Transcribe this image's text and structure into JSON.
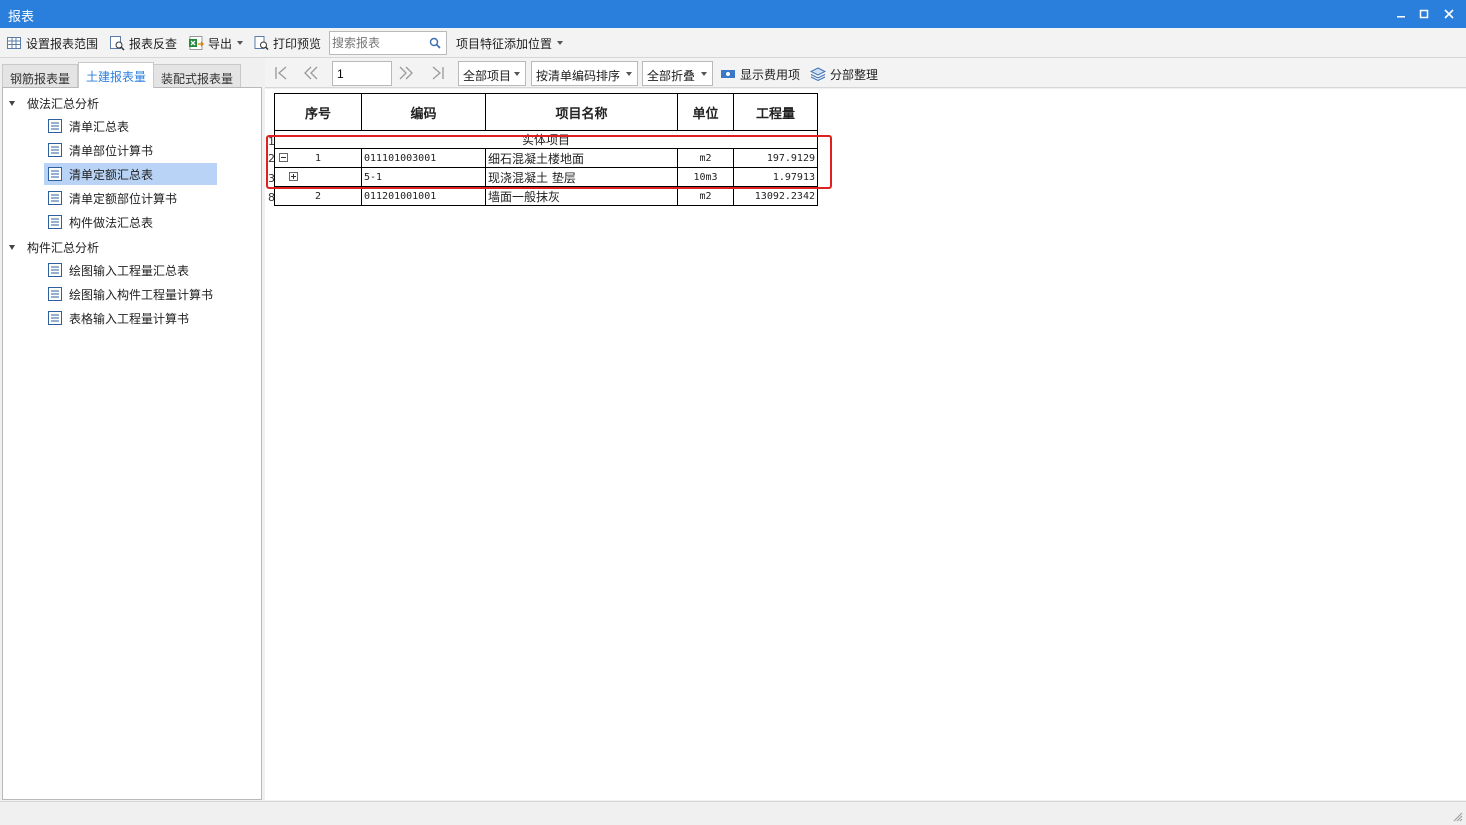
{
  "window": {
    "title": "报表"
  },
  "toolbar": {
    "set_range": "设置报表范围",
    "review": "报表反查",
    "export": "导出",
    "print_preview": "打印预览",
    "search_placeholder": "搜索报表",
    "feature_position": "项目特征添加位置"
  },
  "tabs": [
    {
      "label": "钢筋报表量",
      "active": false
    },
    {
      "label": "土建报表量",
      "active": true
    },
    {
      "label": "装配式报表量",
      "active": false
    }
  ],
  "tree": {
    "group1": {
      "label": "做法汇总分析",
      "items": [
        "清单汇总表",
        "清单部位计算书",
        "清单定额汇总表",
        "清单定额部位计算书",
        "构件做法汇总表"
      ]
    },
    "group2": {
      "label": "构件汇总分析",
      "items": [
        "绘图输入工程量汇总表",
        "绘图输入构件工程量计算书",
        "表格输入工程量计算书"
      ]
    },
    "selected": "清单定额汇总表"
  },
  "report_toolbar": {
    "page": "1",
    "filter": "全部项目",
    "sort": "按清单编码排序",
    "fold": "全部折叠",
    "show_fee": "显示费用项",
    "organize": "分部整理"
  },
  "table": {
    "headers": [
      "序号",
      "编码",
      "项目名称",
      "单位",
      "工程量"
    ],
    "section_label": "实体项目",
    "row_numbers": [
      "1",
      "2",
      "3",
      "8"
    ],
    "rows": [
      {
        "seq": "1",
        "code": "011101003001",
        "name": "细石混凝土楼地面",
        "unit": "m2",
        "qty": "197.9129"
      },
      {
        "seq": "",
        "code": "5-1",
        "name": "现浇混凝土 垫层",
        "unit": "10m3",
        "qty": "1.97913"
      },
      {
        "seq": "2",
        "code": "011201001001",
        "name": "墙面一般抹灰",
        "unit": "m2",
        "qty": "13092.2342"
      }
    ]
  },
  "colors": {
    "titlebar": "#2b7fdc",
    "selection": "#b8d3f5",
    "highlight": "#e02020"
  }
}
